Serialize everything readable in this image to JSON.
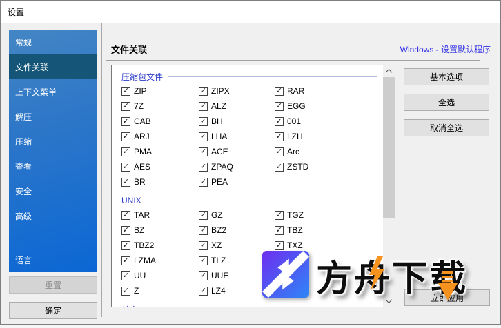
{
  "window": {
    "title": "设置"
  },
  "sidebar": {
    "items": [
      {
        "label": "常规",
        "selected": false,
        "bottom": false
      },
      {
        "label": "文件关联",
        "selected": true,
        "bottom": false
      },
      {
        "label": "上下文菜单",
        "selected": false,
        "bottom": false
      },
      {
        "label": "解压",
        "selected": false,
        "bottom": false
      },
      {
        "label": "压缩",
        "selected": false,
        "bottom": false
      },
      {
        "label": "查看",
        "selected": false,
        "bottom": false
      },
      {
        "label": "安全",
        "selected": false,
        "bottom": false
      },
      {
        "label": "高级",
        "selected": false,
        "bottom": false
      },
      {
        "label": "语言",
        "selected": false,
        "bottom": true
      }
    ],
    "reset_label": "重置",
    "reset_disabled": true,
    "ok_label": "确定"
  },
  "content": {
    "header": "文件关联",
    "default_programs_link": "Windows - 设置默认程序",
    "all_checked": true,
    "groups": [
      {
        "label": "压缩包文件",
        "rows": [
          [
            "ZIP",
            "ZIPX",
            "RAR"
          ],
          [
            "7Z",
            "ALZ",
            "EGG"
          ],
          [
            "CAB",
            "BH",
            "001"
          ],
          [
            "ARJ",
            "LHA",
            "LZH"
          ],
          [
            "PMA",
            "ACE",
            "Arc"
          ],
          [
            "AES",
            "ZPAQ",
            "ZSTD"
          ],
          [
            "BR",
            "PEA",
            null
          ]
        ]
      },
      {
        "label": "UNIX",
        "rows": [
          [
            "TAR",
            "GZ",
            "TGZ"
          ],
          [
            "BZ",
            "BZ2",
            "TBZ"
          ],
          [
            "TBZ2",
            "XZ",
            "TXZ"
          ],
          [
            "LZMA",
            "TLZ",
            null
          ],
          [
            "UU",
            "UUE",
            null
          ],
          [
            "Z",
            "LZ4",
            null
          ]
        ]
      },
      {
        "label": "其它",
        "rows": [],
        "partially_visible": true
      }
    ]
  },
  "action_buttons": {
    "basic_options": "基本选项",
    "select_all": "全选",
    "deselect_all": "取消全选",
    "apply_now": "立即应用"
  },
  "watermark": {
    "text": "方舟下载",
    "logo": "compress-arrows-logo",
    "accent_orange": "#f6921e",
    "logo_gradient_start": "#6d2ef0",
    "logo_gradient_end": "#2f86f7"
  },
  "colors": {
    "sidebar_selected": "#145578",
    "group_label": "#2b3bc7",
    "link": "#3230e3",
    "button_bg": "#e1e1e1",
    "button_border": "#adadad",
    "disabled_text": "#838383"
  }
}
